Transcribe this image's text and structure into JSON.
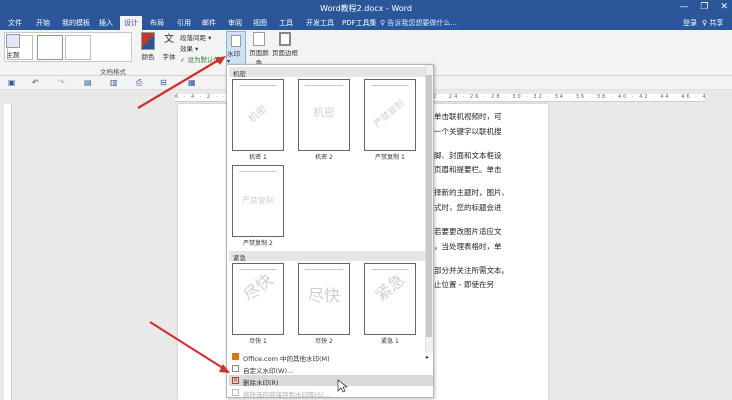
{
  "title_bar": {
    "title": "Word教程2.docx - Word",
    "min": "—",
    "restore": "❐",
    "close": "✕"
  },
  "tabs": [
    "文件",
    "开始",
    "我的模板",
    "插入",
    "设计",
    "布局",
    "引用",
    "邮件",
    "审阅",
    "视图",
    "工具",
    "开发工具",
    "PDF工具集"
  ],
  "tell_me": "♀ 告诉我您想要做什么...",
  "login": "登录",
  "share": "♀ 共享",
  "ribbon": {
    "theme_label": "主题",
    "color_label": "颜色",
    "font_label": "字体",
    "paragraph_spacing": "段落间距 ▾",
    "effects": "效果 ▾",
    "set_default": "✓ 设为默认值",
    "watermark_label": "水印",
    "page_color_label": "页面颜色",
    "page_border_label": "页面边框",
    "doc_format_group": "文档格式"
  },
  "ruler_text": "6 · 4 · 2 · · · 2 · 4 · 6 · 8 · 10 · 12 · 14 · 16 · 18 · 20 · 22 · 24 · 26 · 28 · 30 · 32 · 34 · 36 · 38 · 40 · 42 · 44 · 46 · 48",
  "doc_lines": [
    "单击联机视频时，可",
    "一个关键字以联机搜",
    "脚、封面和文本框设",
    "页眉和提要栏。单击",
    "择新的主题时，图片、",
    "式时，您的标题会进",
    "若要更改图片适应文",
    "，当处理表格时，单",
    "部分并关注所需文本。",
    "止位置 - 即使在另"
  ],
  "watermark_menu": {
    "section_confidential": "机密",
    "section_urgent": "紧急",
    "items": [
      {
        "caption": "机密 1",
        "text": "机密"
      },
      {
        "caption": "机密 2",
        "text": "机密"
      },
      {
        "caption": "严禁复制 1",
        "text": "严禁复制"
      },
      {
        "caption": "严禁复制 2",
        "text": "严禁复制"
      },
      {
        "caption": "尽快 1",
        "text": "尽快"
      },
      {
        "caption": "尽快 2",
        "text": "尽快"
      },
      {
        "caption": "紧急 1",
        "text": "紧急"
      }
    ],
    "more_online": "Office.com 中的其他水印(M)",
    "custom": "自定义水印(W)...",
    "remove": "删除水印(R)",
    "save_selection": "将所选内容保存到水印库(S)..."
  },
  "colors": {
    "accent": "#2b579a",
    "arrow": "#d32f2f"
  }
}
